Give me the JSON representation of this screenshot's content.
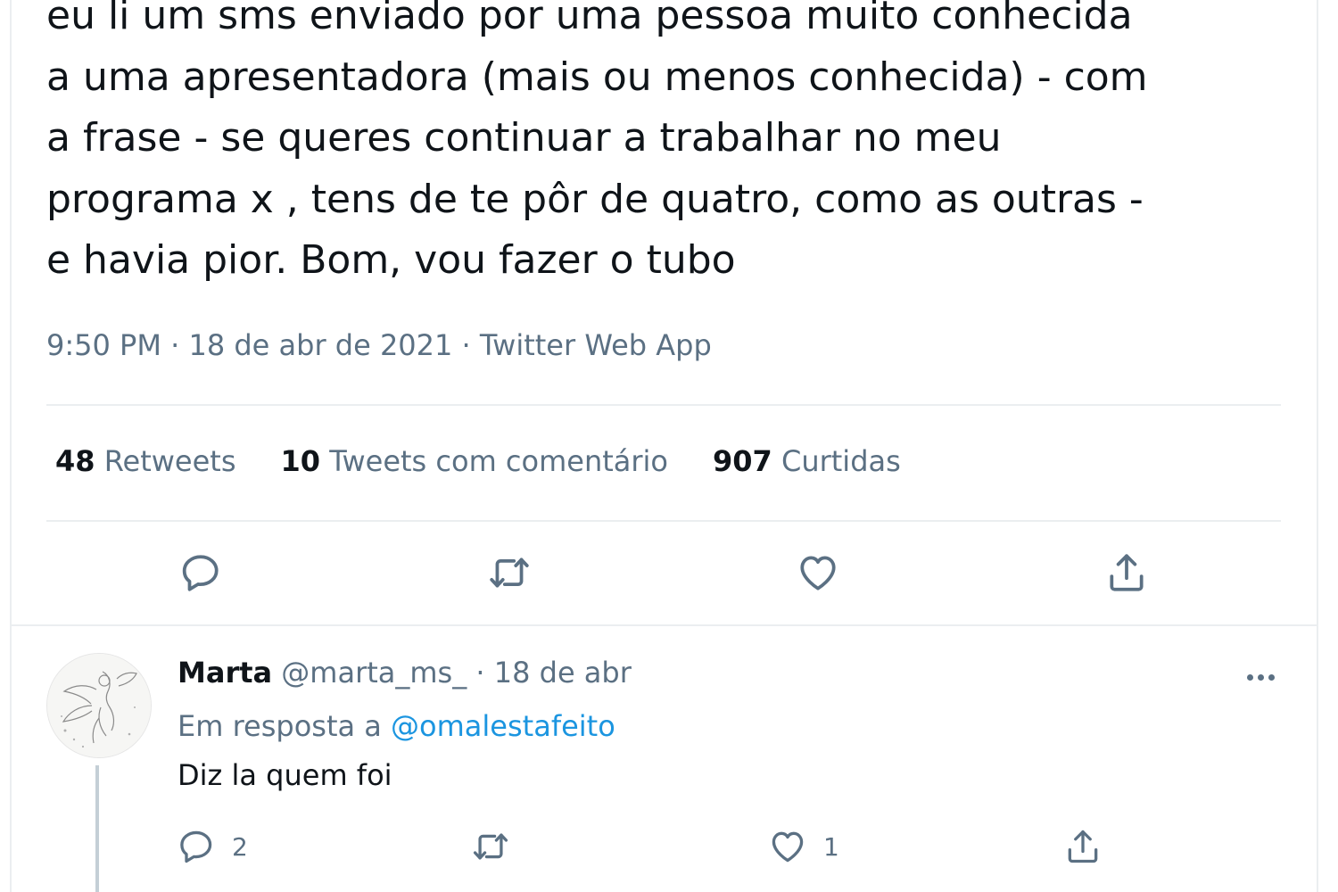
{
  "tweet": {
    "text_lines": [
      "eu li um sms enviado por uma pessoa muito conhecida",
      "a uma apresentadora (mais ou menos conhecida) - com",
      "a frase - se queres continuar a trabalhar no meu",
      "programa x , tens de te pôr de quatro, como as outras -",
      "e havia pior. Bom, vou fazer o tubo"
    ],
    "time": "9:50 PM",
    "date": "18 de abr de 2021",
    "source": "Twitter Web App",
    "separator": " · "
  },
  "stats": {
    "retweets_count": "48",
    "retweets_label": "Retweets",
    "quotes_count": "10",
    "quotes_label": "Tweets com comentário",
    "likes_count": "907",
    "likes_label": "Curtidas"
  },
  "actions": {
    "icons": [
      "reply-icon",
      "retweet-icon",
      "like-icon",
      "share-icon"
    ]
  },
  "reply": {
    "name": "Marta",
    "handle": "@marta_ms_",
    "dot": "·",
    "date": "18 de abr",
    "in_reply_prefix": "Em resposta a",
    "in_reply_handle": "@omalestafeito",
    "text": "Diz la quem foi",
    "reply_count": "2",
    "retweet_count": "",
    "like_count": "1"
  },
  "colors": {
    "text": "#0f1419",
    "secondary": "#5b7083",
    "link": "#1b95e0",
    "border": "#ebeef0"
  }
}
